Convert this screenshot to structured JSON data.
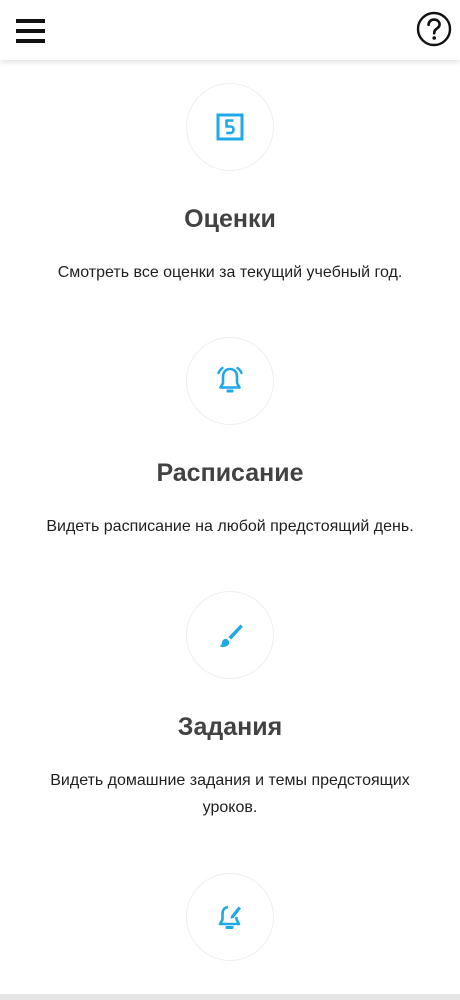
{
  "header": {
    "menu_icon": "hamburger-menu-icon",
    "help_icon": "help-question-icon"
  },
  "accent_color": "#1fa8e6",
  "features": [
    {
      "icon": "grade-five-icon",
      "title": "Оценки",
      "description": "Смотреть все оценки за текущий учебный год."
    },
    {
      "icon": "bell-icon",
      "title": "Расписание",
      "description": "Видеть расписание на любой предстоящий день."
    },
    {
      "icon": "brush-icon",
      "title": "Задания",
      "description": "Видеть домашние задания и темы предстоящих уроков."
    },
    {
      "icon": "bell-edit-icon"
    }
  ]
}
